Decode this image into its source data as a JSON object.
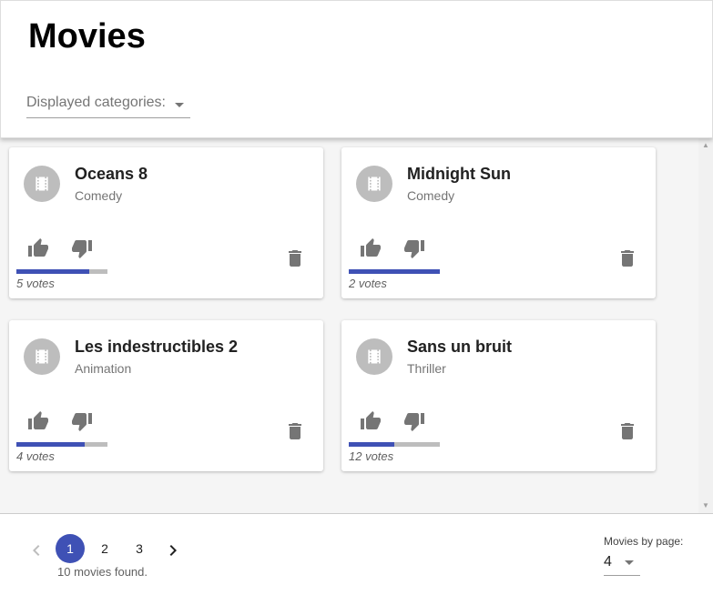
{
  "header": {
    "title": "Movies",
    "categories_placeholder": "Displayed categories:"
  },
  "movies": [
    {
      "name": "Oceans 8",
      "category": "Comedy",
      "votes_label": "5 votes",
      "like_ratio": 0.8
    },
    {
      "name": "Midnight Sun",
      "category": "Comedy",
      "votes_label": "2 votes",
      "like_ratio": 1.0
    },
    {
      "name": "Les indestructibles 2",
      "category": "Animation",
      "votes_label": "4 votes",
      "like_ratio": 0.75
    },
    {
      "name": "Sans un bruit",
      "category": "Thriller",
      "votes_label": "12 votes",
      "like_ratio": 0.5
    }
  ],
  "pagination": {
    "pages": [
      "1",
      "2",
      "3"
    ],
    "current": "1",
    "found_text": "10 movies found."
  },
  "per_page": {
    "label": "Movies by page:",
    "value": "4"
  },
  "colors": {
    "accent": "#3f51b5",
    "bar_background": "#bdbdbd",
    "icon": "#757575"
  }
}
